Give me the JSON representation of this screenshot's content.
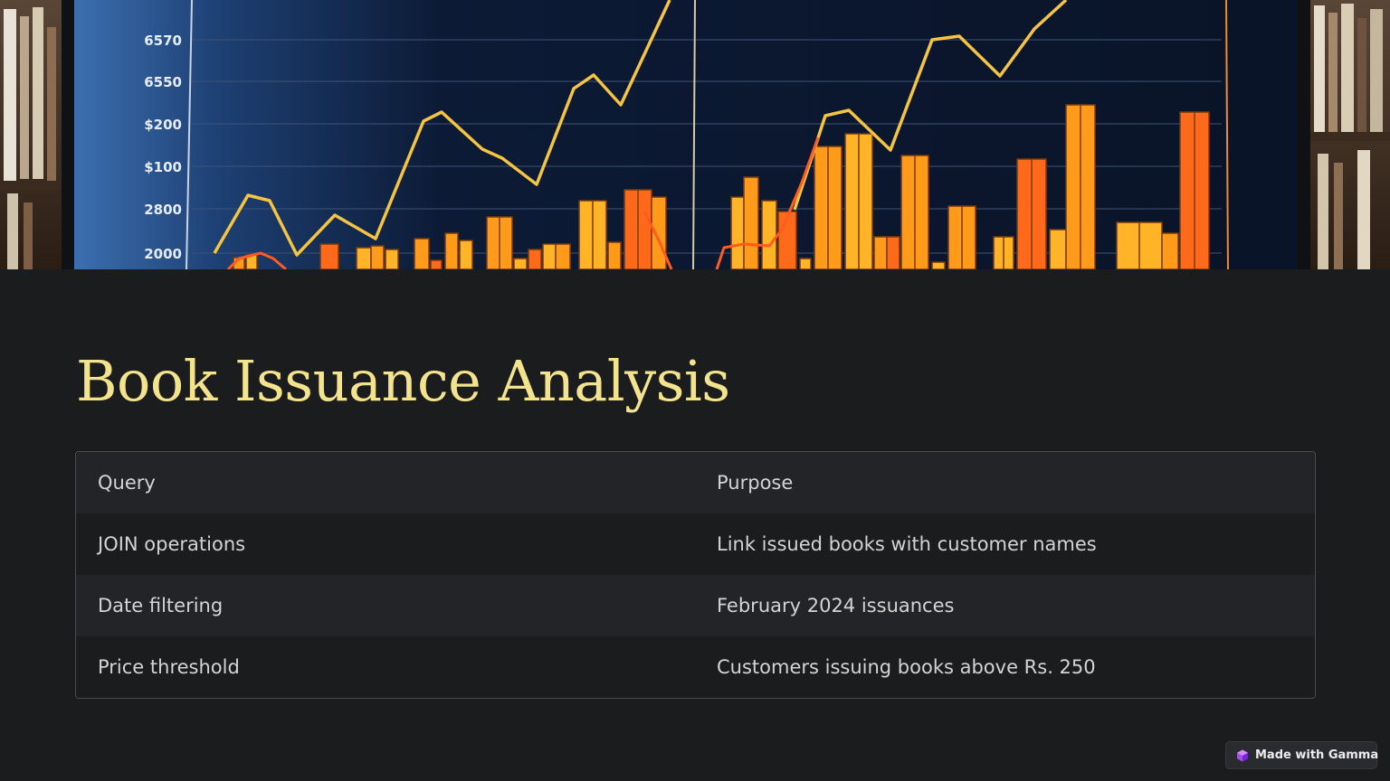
{
  "hero": {
    "y_tick_labels": [
      "6570",
      "6550",
      "$200",
      "$100",
      "2800",
      "2000"
    ],
    "line_color": "#f5c542",
    "bar_colors": [
      "#ff9a1a",
      "#ffb428",
      "#ff6a1a"
    ]
  },
  "title": "Book Issuance Analysis",
  "table": {
    "headers": [
      "Query",
      "Purpose"
    ],
    "rows": [
      [
        "JOIN operations",
        "Link issued books with customer names"
      ],
      [
        "Date filtering",
        "February 2024 issuances"
      ],
      [
        "Price threshold",
        "Customers issuing books above Rs. 250"
      ]
    ]
  },
  "badge": {
    "label": "Made with Gamma",
    "icon": "gamma-logo-icon"
  },
  "colors": {
    "background": "#1b1c1e",
    "title": "#f3e38d",
    "text": "#d4d4d6",
    "row_alt": "#232427",
    "border": "#4a4b4e"
  }
}
